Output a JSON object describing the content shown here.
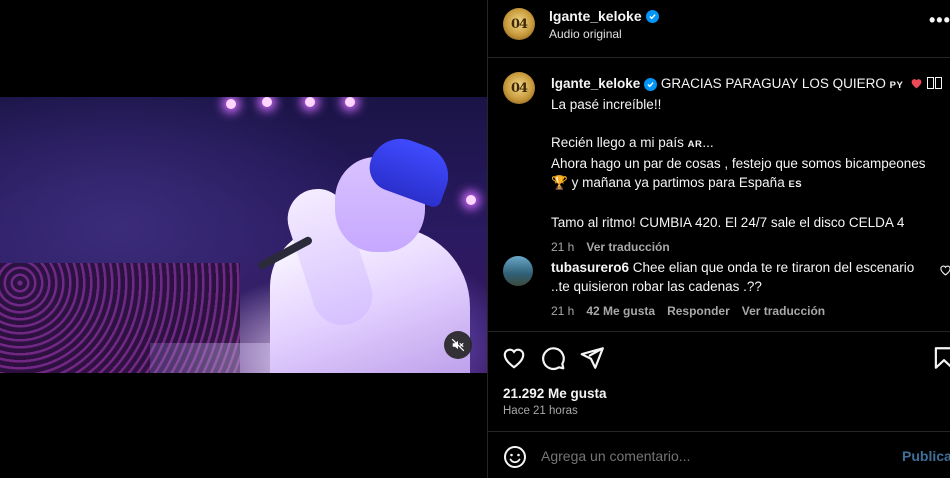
{
  "post": {
    "username": "lgante_keloke",
    "audio_label": "Audio original",
    "avatar_text": "04",
    "more_label": "•••"
  },
  "caption": {
    "username": "lgante_keloke",
    "line1": "GRACIAS PARAGUAY LOS QUIERO",
    "flag_py": "PY",
    "line2": "La pasé increíble!!",
    "line3": "Recién llego a mi país",
    "flag_ar": "AR",
    "line3_end": "...",
    "line4": "Ahora hago un par de cosas , festejo que somos bicampeones",
    "trophy": "🏆",
    "line5": "y mañana ya partimos para España",
    "flag_es": "ES",
    "line6": "Tamo al ritmo! CUMBIA 420. El 24/7 sale el disco CELDA 4",
    "time": "21 h",
    "translate": "Ver traducción"
  },
  "comment": {
    "username": "tubasurero6",
    "text": "Chee elian que onda te re tiraron del escenario ..te quisieron robar las cadenas .??",
    "time": "21 h",
    "likes": "42 Me gusta",
    "reply": "Responder",
    "translate": "Ver traducción"
  },
  "stats": {
    "likes": "21.292 Me gusta",
    "posted": "Hace 21 horas"
  },
  "add_comment": {
    "placeholder": "Agrega un comentario...",
    "publish": "Publicar"
  },
  "colors": {
    "accent": "#0095f6",
    "heart": "#ed4956",
    "muted": "#a8a8a8"
  }
}
